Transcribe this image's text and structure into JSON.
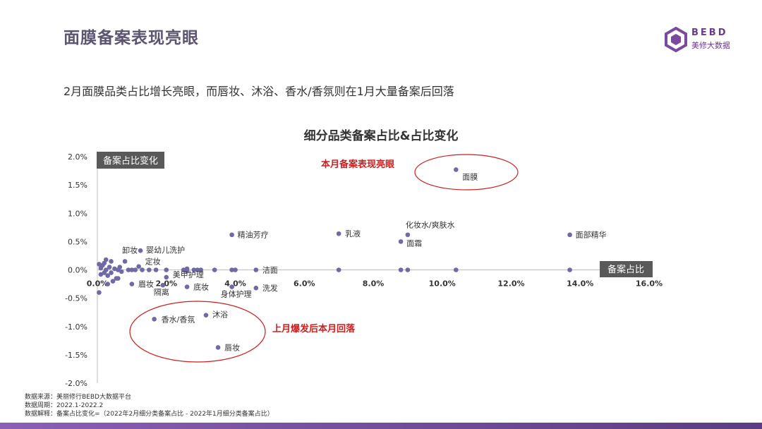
{
  "header": {
    "title": "面膜备案表现亮眼",
    "subtitle": "2月面膜品类占比增长亮眼，而唇妆、沐浴、香水/香氛则在1月大量备案后回落"
  },
  "logo": {
    "en": "BEBD",
    "cn": "美修大数据"
  },
  "footnotes": [
    "数据来源：美丽修行BEBD大数据平台",
    "数据周期：2022.1-2022.2",
    "数据解释：备案占比变化=（2022年2月细分类备案占比 - 2022年1月细分类备案占比）"
  ],
  "colors": {
    "point": "#6f6aa3",
    "annotation": "#cc1f1f",
    "axis_label_bg": "#595959",
    "brand": "#6a3c8c"
  },
  "chart_data": {
    "type": "scatter",
    "title": "细分品类备案占比&占比变化",
    "xlabel": "备案占比",
    "ylabel": "备案占比变化",
    "xlim": [
      0,
      16
    ],
    "ylim": [
      -2,
      2
    ],
    "x_ticks": [
      "0.0%",
      "2.0%",
      "4.0%",
      "6.0%",
      "8.0%",
      "10.0%",
      "12.0%",
      "14.0%",
      "16.0%"
    ],
    "y_ticks": [
      "2.0%",
      "1.5%",
      "1.0%",
      "0.5%",
      "0.0%",
      "-0.5%",
      "-1.0%",
      "-1.5%",
      "-2.0%"
    ],
    "points": [
      {
        "label": "面膜",
        "x": 10.4,
        "y": 1.77
      },
      {
        "label": "精油芳疗",
        "x": 3.9,
        "y": 0.62
      },
      {
        "label": "乳液",
        "x": 7.0,
        "y": 0.64
      },
      {
        "label": "化妆水/爽肤水",
        "x": 9.0,
        "y": 0.62
      },
      {
        "label": "面霜",
        "x": 8.8,
        "y": 0.5
      },
      {
        "label": "面部精华",
        "x": 13.7,
        "y": 0.62
      },
      {
        "label": "婴幼儿洗护",
        "x": 1.25,
        "y": 0.34
      },
      {
        "label": "卸妆",
        "x": 0.8,
        "y": 0.15
      },
      {
        "label": "定妆",
        "x": 1.2,
        "y": 0.06
      },
      {
        "label": "洁面",
        "x": 4.6,
        "y": 0.0
      },
      {
        "label": "眉妆",
        "x": 1.0,
        "y": -0.25
      },
      {
        "label": "美甲护理",
        "x": 2.0,
        "y": -0.13
      },
      {
        "label": "隔离",
        "x": 1.9,
        "y": -0.27
      },
      {
        "label": "底妆",
        "x": 2.6,
        "y": -0.3
      },
      {
        "label": "身体护理",
        "x": 3.9,
        "y": -0.3
      },
      {
        "label": "洗发",
        "x": 4.6,
        "y": -0.32
      },
      {
        "label": "香水/香氛",
        "x": 1.65,
        "y": -0.87
      },
      {
        "label": "沐浴",
        "x": 3.15,
        "y": -0.8
      },
      {
        "label": "唇妆",
        "x": 3.5,
        "y": -1.37
      },
      {
        "label": "",
        "x": 0.05,
        "y": 0.1
      },
      {
        "label": "",
        "x": 0.1,
        "y": 0.03
      },
      {
        "label": "",
        "x": 0.15,
        "y": 0.08
      },
      {
        "label": "",
        "x": 0.2,
        "y": -0.05
      },
      {
        "label": "",
        "x": 0.25,
        "y": 0.0
      },
      {
        "label": "",
        "x": 0.3,
        "y": -0.1
      },
      {
        "label": "",
        "x": 0.35,
        "y": 0.05
      },
      {
        "label": "",
        "x": 0.4,
        "y": 0.15
      },
      {
        "label": "",
        "x": 0.45,
        "y": -0.2
      },
      {
        "label": "",
        "x": 0.5,
        "y": 0.02
      },
      {
        "label": "",
        "x": 0.55,
        "y": -0.15
      },
      {
        "label": "",
        "x": 0.6,
        "y": 0.0
      },
      {
        "label": "",
        "x": 0.65,
        "y": 0.05
      },
      {
        "label": "",
        "x": 0.7,
        "y": -0.03
      },
      {
        "label": "",
        "x": 0.1,
        "y": -0.08
      },
      {
        "label": "",
        "x": 0.2,
        "y": 0.12
      },
      {
        "label": "",
        "x": 0.3,
        "y": -0.25
      },
      {
        "label": "",
        "x": 0.05,
        "y": -0.4
      },
      {
        "label": "",
        "x": 0.25,
        "y": 0.18
      },
      {
        "label": "",
        "x": 0.4,
        "y": -0.05
      },
      {
        "label": "",
        "x": 0.9,
        "y": 0.0
      },
      {
        "label": "",
        "x": 1.0,
        "y": 0.0
      },
      {
        "label": "",
        "x": 1.1,
        "y": 0.0
      },
      {
        "label": "",
        "x": 1.3,
        "y": 0.0
      },
      {
        "label": "",
        "x": 1.5,
        "y": 0.0
      },
      {
        "label": "",
        "x": 1.7,
        "y": 0.0
      },
      {
        "label": "",
        "x": 2.0,
        "y": 0.0
      },
      {
        "label": "",
        "x": 2.5,
        "y": 0.0
      },
      {
        "label": "",
        "x": 2.6,
        "y": 0.02
      },
      {
        "label": "",
        "x": 2.8,
        "y": 0.0
      },
      {
        "label": "",
        "x": 2.9,
        "y": 0.0
      },
      {
        "label": "",
        "x": 3.0,
        "y": 0.0
      },
      {
        "label": "",
        "x": 3.4,
        "y": 0.0
      },
      {
        "label": "",
        "x": 3.9,
        "y": 0.0
      },
      {
        "label": "",
        "x": 4.0,
        "y": 0.0
      },
      {
        "label": "",
        "x": 7.0,
        "y": 0.0
      },
      {
        "label": "",
        "x": 8.8,
        "y": 0.0
      },
      {
        "label": "",
        "x": 9.0,
        "y": 0.0
      },
      {
        "label": "",
        "x": 10.4,
        "y": 0.0
      },
      {
        "label": "",
        "x": 13.7,
        "y": 0.0
      },
      {
        "label": "",
        "x": 0.6,
        "y": -0.15
      },
      {
        "label": "",
        "x": 2.6,
        "y": -0.02
      }
    ],
    "annotations": [
      {
        "text": "本月备案表现亮眼"
      },
      {
        "text": "上月爆发后本月回落"
      }
    ]
  }
}
